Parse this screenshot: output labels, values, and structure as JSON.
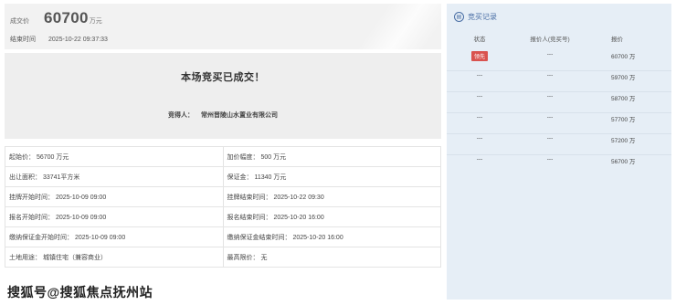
{
  "summary": {
    "price_label": "成交价",
    "price_value": "60700",
    "price_unit": "万元",
    "end_time_label": "结束时间",
    "end_time_value": "2025-10-22 09:37:33"
  },
  "result": {
    "title": "本场竞买已成交！",
    "winner_label": "竞得人：",
    "winner_name": "常州晋陵山水置业有限公司"
  },
  "details": [
    [
      "起始价： 56700 万元",
      "加价幅度： 500 万元"
    ],
    [
      "出让面积： 33741平方米",
      "保证金： 11340 万元"
    ],
    [
      "挂牌开始时间： 2025-10-09 09:00",
      "挂牌结束时间： 2025-10-22 09:30"
    ],
    [
      "报名开始时间： 2025-10-09 09:00",
      "报名结束时间： 2025-10-20 16:00"
    ],
    [
      "缴纳保证金开始时间： 2025-10-09 09:00",
      "缴纳保证金结束时间： 2025-10-20 16:00"
    ],
    [
      "土地用途： 城镇住宅（兼容商业）",
      "最高限价： 无"
    ]
  ],
  "records": {
    "title": "竞买记录",
    "icon": "document-icon",
    "columns": [
      "状态",
      "报价人(竞买号)",
      "报价"
    ],
    "rows": [
      {
        "status": "领先",
        "bidder": "---",
        "price": "60700 万"
      },
      {
        "status": "---",
        "bidder": "---",
        "price": "59700 万"
      },
      {
        "status": "---",
        "bidder": "---",
        "price": "58700 万"
      },
      {
        "status": "---",
        "bidder": "---",
        "price": "57700 万"
      },
      {
        "status": "---",
        "bidder": "---",
        "price": "57200 万"
      },
      {
        "status": "---",
        "bidder": "---",
        "price": "56700 万"
      }
    ]
  },
  "watermark": "搜狐号@搜狐焦点抚州站",
  "colors": {
    "leading_badge": "#d9534f",
    "record_panel": "#e6eef6",
    "accent": "#4a6fa5"
  }
}
